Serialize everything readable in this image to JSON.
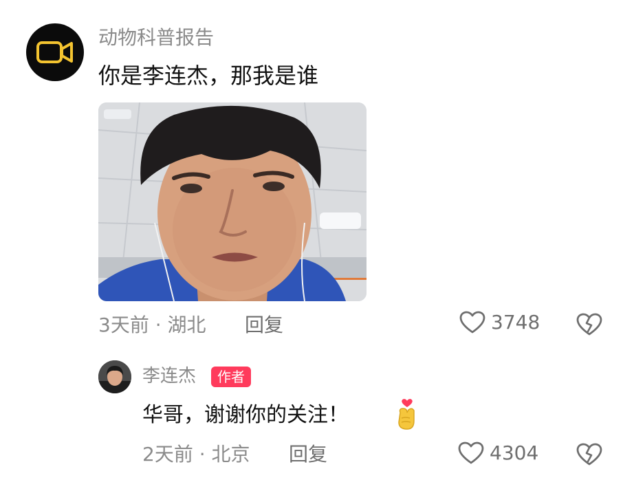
{
  "comment": {
    "username": "动物科普报告",
    "text": "你是李连杰，那我是谁",
    "time_location": "3天前 · 湖北",
    "reply_label": "回复",
    "likes": "3748",
    "icons": {
      "avatar": "video-camera-icon",
      "like": "heart-outline-icon",
      "dislike": "broken-heart-icon"
    }
  },
  "reply": {
    "username": "李连杰",
    "badge": "作者",
    "text": "华哥，谢谢你的关注！",
    "emoji": "finger-heart-emoji",
    "time_location": "2天前 · 北京",
    "reply_label": "回复",
    "likes": "4304"
  },
  "colors": {
    "accent_badge": "#ff3b5c",
    "avatar_icon": "#f4c430",
    "muted_text": "#8a8a8a"
  }
}
